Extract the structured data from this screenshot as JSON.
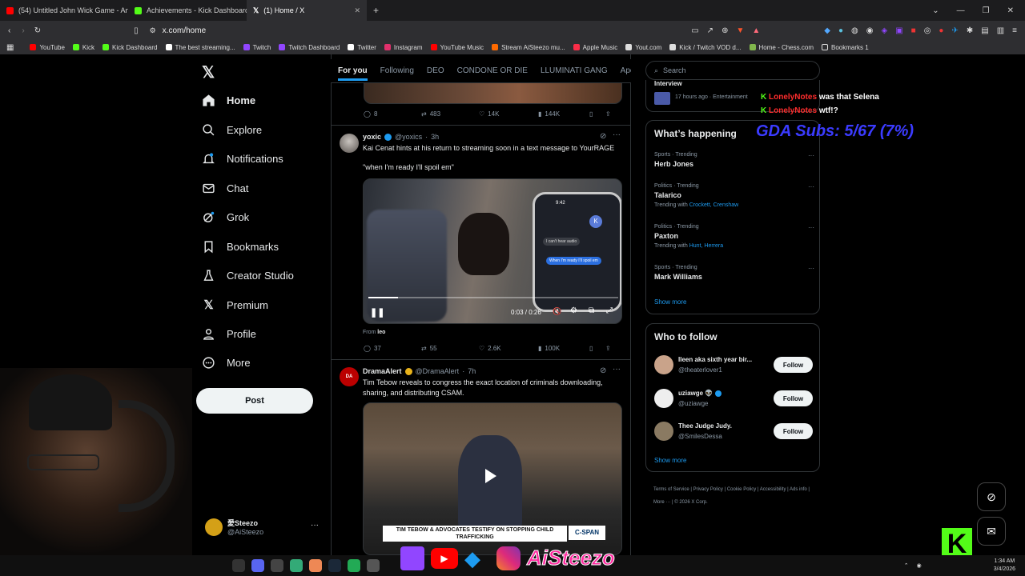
{
  "browser": {
    "tabs": [
      {
        "label": "(54) Untitled John Wick Game - Anno",
        "color": "#ff0000"
      },
      {
        "label": "Achievements - Kick Dashboard",
        "color": "#53fc18"
      },
      {
        "label": "(1) Home / X",
        "color": "#ffffff"
      }
    ],
    "url": "x.com/home",
    "bookmarks": [
      {
        "label": "YouTube",
        "color": "#ff0000"
      },
      {
        "label": "Kick",
        "color": "#53fc18"
      },
      {
        "label": "Kick Dashboard",
        "color": "#53fc18"
      },
      {
        "label": "The best streaming...",
        "color": "#ffffff"
      },
      {
        "label": "Twitch",
        "color": "#9146ff"
      },
      {
        "label": "Twitch Dashboard",
        "color": "#9146ff"
      },
      {
        "label": "Twitter",
        "color": "#ffffff"
      },
      {
        "label": "Instagram",
        "color": "#e1306c"
      },
      {
        "label": "YouTube Music",
        "color": "#ff0000"
      },
      {
        "label": "Stream AiSteezo mu...",
        "color": "#ff6a00"
      },
      {
        "label": "Apple Music",
        "color": "#fa2d48"
      },
      {
        "label": "Yout.com",
        "color": "#dddddd"
      },
      {
        "label": "Kick / Twitch VOD d...",
        "color": "#dddddd"
      },
      {
        "label": "Home - Chess.com",
        "color": "#81b64c"
      },
      {
        "label": "Bookmarks 1",
        "color": "#dddddd"
      }
    ]
  },
  "sidebar": {
    "items": [
      {
        "label": "Home"
      },
      {
        "label": "Explore"
      },
      {
        "label": "Notifications"
      },
      {
        "label": "Chat"
      },
      {
        "label": "Grok"
      },
      {
        "label": "Bookmarks"
      },
      {
        "label": "Creator Studio"
      },
      {
        "label": "Premium"
      },
      {
        "label": "Profile"
      },
      {
        "label": "More"
      }
    ],
    "post_label": "Post",
    "account_name": "愛Steezo",
    "account_handle": "@AiSteezo"
  },
  "feed": {
    "tabs": [
      "For you",
      "Following",
      "DEO",
      "CONDONE OR DIE",
      "LLUMINATI GANG",
      "Ape"
    ],
    "prev_stats": {
      "replies": "8",
      "reposts": "483",
      "likes": "14K",
      "views": "144K"
    },
    "posts": [
      {
        "name": "yoxic",
        "handle": "@yoxics",
        "time": "3h",
        "text": "Kai Cenat hints at his return to streaming soon in a text message to YourRAGE",
        "quote": "\"when I'm ready I'll spoil em\"",
        "video_time": "0:03 / 0:26",
        "video_progress": 0.12,
        "from_label": "From",
        "from_user": "leo",
        "phone_msgs": [
          "I can't hear audio",
          "When I'm ready I'll spoil em"
        ],
        "stats": {
          "replies": "37",
          "reposts": "55",
          "likes": "2.6K",
          "views": "100K"
        }
      },
      {
        "name": "DramaAlert",
        "handle": "@DramaAlert",
        "time": "7h",
        "text": "Tim Tebow reveals to congress the exact location of criminals downloading, sharing, and distributing CSAM.",
        "chyron": "TIM TEBOW & ADVOCATES TESTIFY ON STOPPING CHILD TRAFFICKING",
        "network": "C-SPAN"
      }
    ]
  },
  "right": {
    "search_placeholder": "Search",
    "top_item": {
      "title": "Interview",
      "meta": "17 hours ago · Entertainment"
    },
    "happening_title": "What’s happening",
    "trends": [
      {
        "meta": "Sports · Trending",
        "title": "Herb Jones",
        "with": ""
      },
      {
        "meta": "Politics · Trending",
        "title": "Talarico",
        "with_prefix": "Trending with",
        "with": "Crockett, Crenshaw"
      },
      {
        "meta": "Politics · Trending",
        "title": "Paxton",
        "with_prefix": "Trending with",
        "with": "Hunt, Herrera"
      },
      {
        "meta": "Sports · Trending",
        "title": "Mark Williams",
        "with": ""
      }
    ],
    "show_more": "Show more",
    "wtf_title": "Who to follow",
    "follow": [
      {
        "name": "Ileen aka sixth year bir...",
        "handle": "@theaterlover1"
      },
      {
        "name": "uziawge 👽",
        "handle": "@uziawge"
      },
      {
        "name": "Thee Judge Judy.",
        "handle": "@SmilesDessa"
      }
    ],
    "follow_label": "Follow",
    "footer": [
      "Terms of Service",
      "Privacy Policy",
      "Cookie Policy",
      "Accessibility",
      "Ads info",
      "More ···",
      "© 2026 X Corp."
    ]
  },
  "overlay": {
    "chat": [
      {
        "user": "LonelyNotes",
        "msg": "was that Selena"
      },
      {
        "user": "LonelyNotes",
        "msg": "wtf!?"
      }
    ],
    "subs": "GDA Subs: 5/67 (7%)",
    "brand": "AiSteezo"
  },
  "taskbar": {
    "time": "1:34 AM",
    "date": "3/4/2026"
  }
}
